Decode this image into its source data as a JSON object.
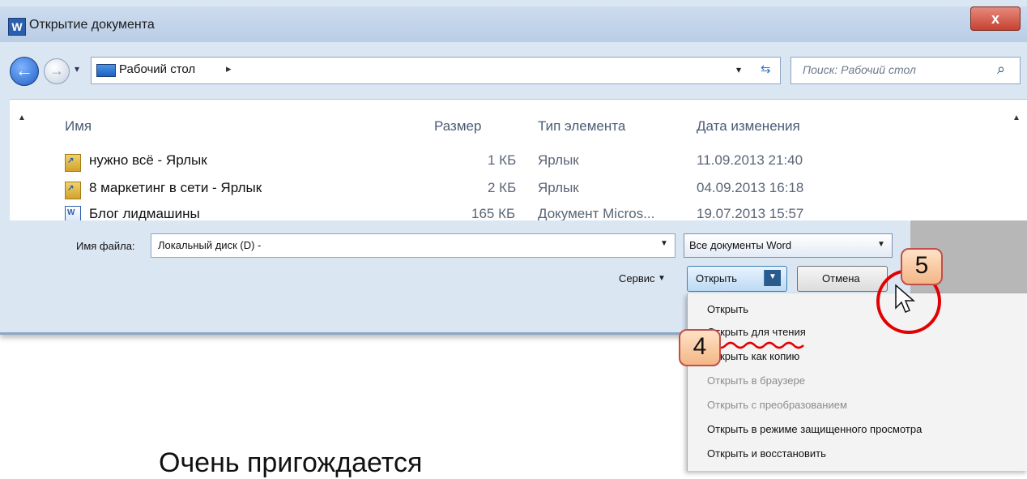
{
  "window": {
    "title": "Открытие документа",
    "app_icon": "W",
    "close": "x"
  },
  "nav": {
    "back": "←",
    "forward": "→",
    "address": "Рабочий стол",
    "address_arrow": "▸",
    "search_placeholder": "Поиск: Рабочий стол"
  },
  "columns": {
    "name": "Имя",
    "size": "Размер",
    "type": "Тип элемента",
    "date": "Дата изменения"
  },
  "files": [
    {
      "name": "нужно всё - Ярлык",
      "size": "1 КБ",
      "type": "Ярлык",
      "date": "11.09.2013 21:40",
      "icon": "shortcut-icon"
    },
    {
      "name": "8 маркетинг в сети - Ярлык",
      "size": "2 КБ",
      "type": "Ярлык",
      "date": "04.09.2013 16:18",
      "icon": "shortcut-icon"
    },
    {
      "name": "Блог лидмашины",
      "size": "165 КБ",
      "type": "Документ Micros...",
      "date": "19.07.2013 15:57",
      "icon": "word-doc-icon"
    }
  ],
  "filename": {
    "label": "Имя файла:",
    "value": "Локальный диск (D) -"
  },
  "filter": {
    "value": "Все документы Word"
  },
  "buttons": {
    "service": "Сервис",
    "open": "Открыть",
    "cancel": "Отмена"
  },
  "open_menu": [
    {
      "label": "Открыть",
      "enabled": true
    },
    {
      "label": "Открыть для чтения",
      "enabled": true
    },
    {
      "label": "Открыть как копию",
      "enabled": true
    },
    {
      "label": "Открыть в браузере",
      "enabled": false
    },
    {
      "label": "Открыть с преобразованием",
      "enabled": false
    },
    {
      "label": "Открыть в режиме защищенного просмотра",
      "enabled": true
    },
    {
      "label": "Открыть и восстановить",
      "enabled": true
    }
  ],
  "callouts": {
    "step4": "4",
    "step5": "5"
  },
  "slide": {
    "bullet": "",
    "text": "Очень пригождается"
  },
  "colors": {
    "accent": "#2b5fad",
    "annotation_red": "#e30000",
    "callout_fill": "#f3b686"
  }
}
